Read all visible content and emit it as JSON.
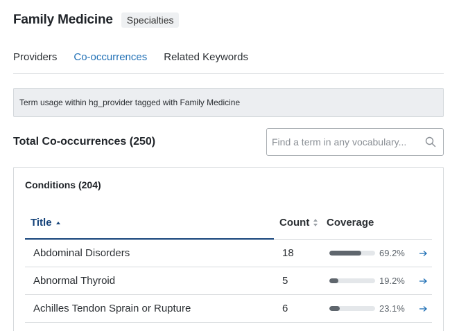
{
  "header": {
    "title": "Family Medicine",
    "badge": "Specialties"
  },
  "tabs": [
    {
      "label": "Providers",
      "active": false
    },
    {
      "label": "Co-occurrences",
      "active": true
    },
    {
      "label": "Related Keywords",
      "active": false
    }
  ],
  "banner": {
    "text": "Term usage within hg_provider tagged with Family Medicine"
  },
  "total": {
    "heading": "Total Co-occurrences (250)"
  },
  "search": {
    "placeholder": "Find a term in any vocabulary...",
    "value": ""
  },
  "panel": {
    "title": "Conditions (204)",
    "columns": {
      "title": "Title",
      "count": "Count",
      "coverage": "Coverage"
    },
    "rows": [
      {
        "title": "Abdominal Disorders",
        "count": "18",
        "coverage": "69.2%",
        "coverage_value": 0.692
      },
      {
        "title": "Abnormal Thyroid",
        "count": "5",
        "coverage": "19.2%",
        "coverage_value": 0.192
      },
      {
        "title": "Achilles Tendon Sprain or Rupture",
        "count": "6",
        "coverage": "23.1%",
        "coverage_value": 0.231
      }
    ]
  },
  "colors": {
    "accent": "#1f6fb5",
    "sort_active": "#15437a",
    "bar_fill": "#5f666d",
    "bar_track": "#e4e7ea",
    "arrow": "#1f6fb5"
  },
  "icons": {
    "search": "search-icon",
    "row_link": "arrow-right-icon"
  }
}
